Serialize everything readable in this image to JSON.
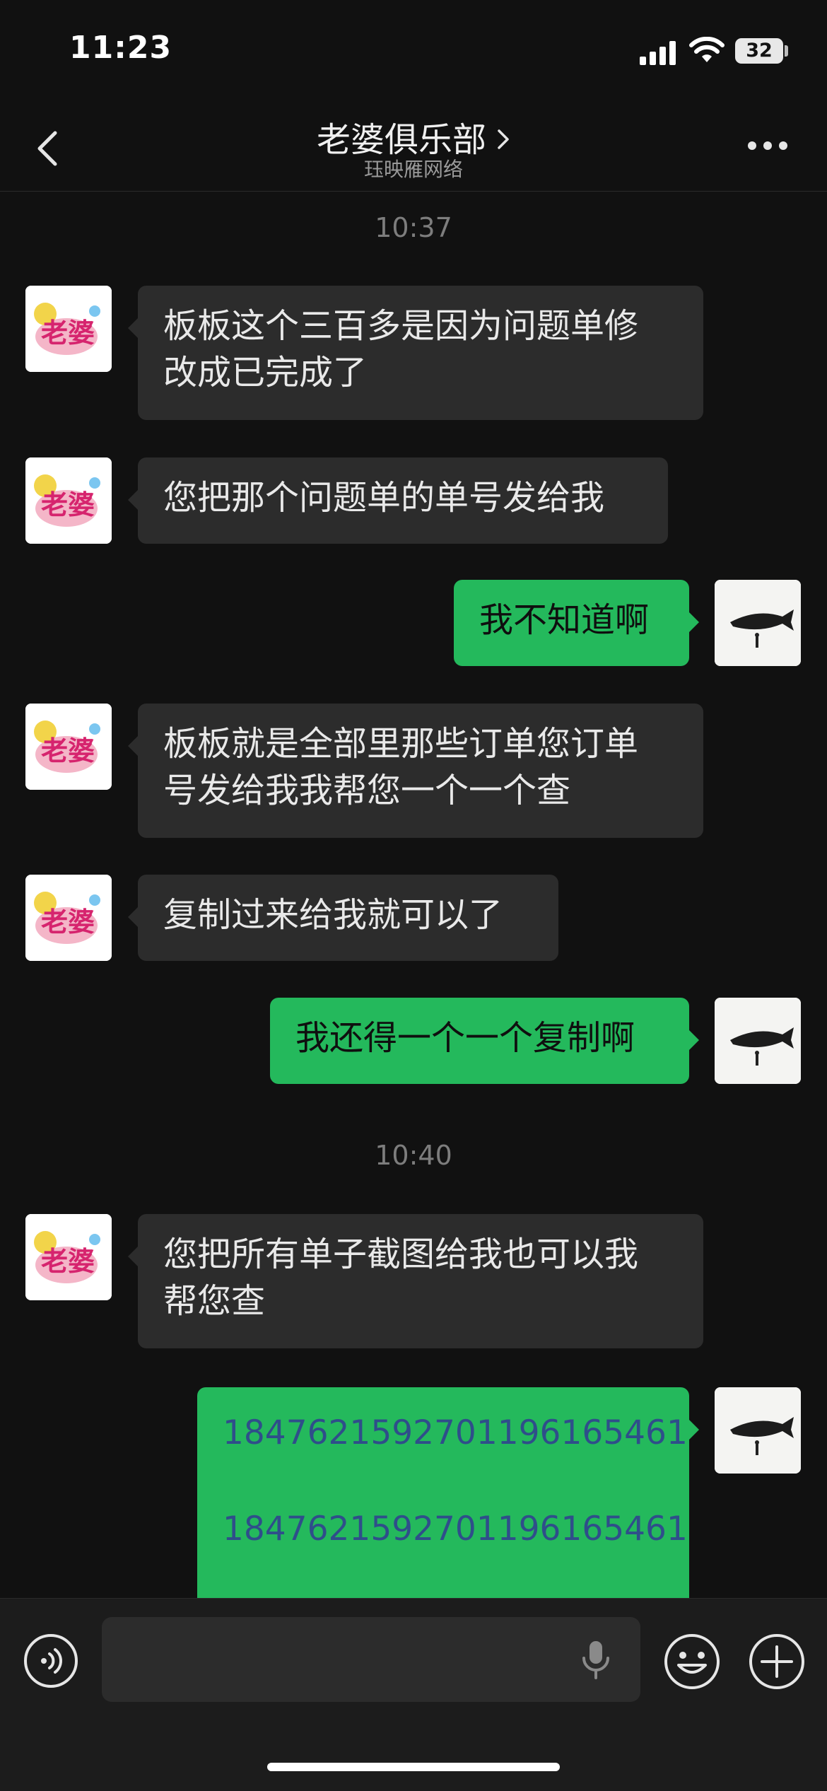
{
  "status_bar": {
    "time": "11:23",
    "battery": "32"
  },
  "nav": {
    "title": "老婆俱乐部",
    "subtitle": "珏映雁网络"
  },
  "timestamps": [
    "10:37",
    "10:40"
  ],
  "messages": [
    {
      "from": "them",
      "text_lines": [
        "板板这个三百多是因为问题单修",
        "改成已完成了"
      ]
    },
    {
      "from": "them",
      "text_lines": [
        "您把那个问题单的单号发给我"
      ]
    },
    {
      "from": "me",
      "text_lines": [
        "我不知道啊"
      ]
    },
    {
      "from": "them",
      "text_lines": [
        "板板就是全部里那些订单您订单",
        "号发给我我帮您一个一个查"
      ]
    },
    {
      "from": "them",
      "text_lines": [
        "复制过来给我就可以了"
      ]
    },
    {
      "from": "me",
      "text_lines": [
        "我还得一个一个复制啊"
      ]
    },
    {
      "from": "them",
      "text_lines": [
        "您把所有单子截图给我也可以我",
        "帮您查"
      ]
    },
    {
      "from": "me",
      "text_lines": [
        "1847621592701196165461",
        "1847621592701196165461"
      ]
    }
  ],
  "icons": {
    "back": "chevron-left-icon",
    "more": "more-dots-icon",
    "voice": "voice-icon",
    "mic": "microphone-icon",
    "emoji": "emoji-icon",
    "plus": "plus-icon"
  },
  "colors": {
    "background": "#111111",
    "incoming_bubble": "#2c2c2c",
    "outgoing_bubble": "#24b95c",
    "order_number_text": "#2f4e8a",
    "timestamp": "#7d7d7d"
  }
}
